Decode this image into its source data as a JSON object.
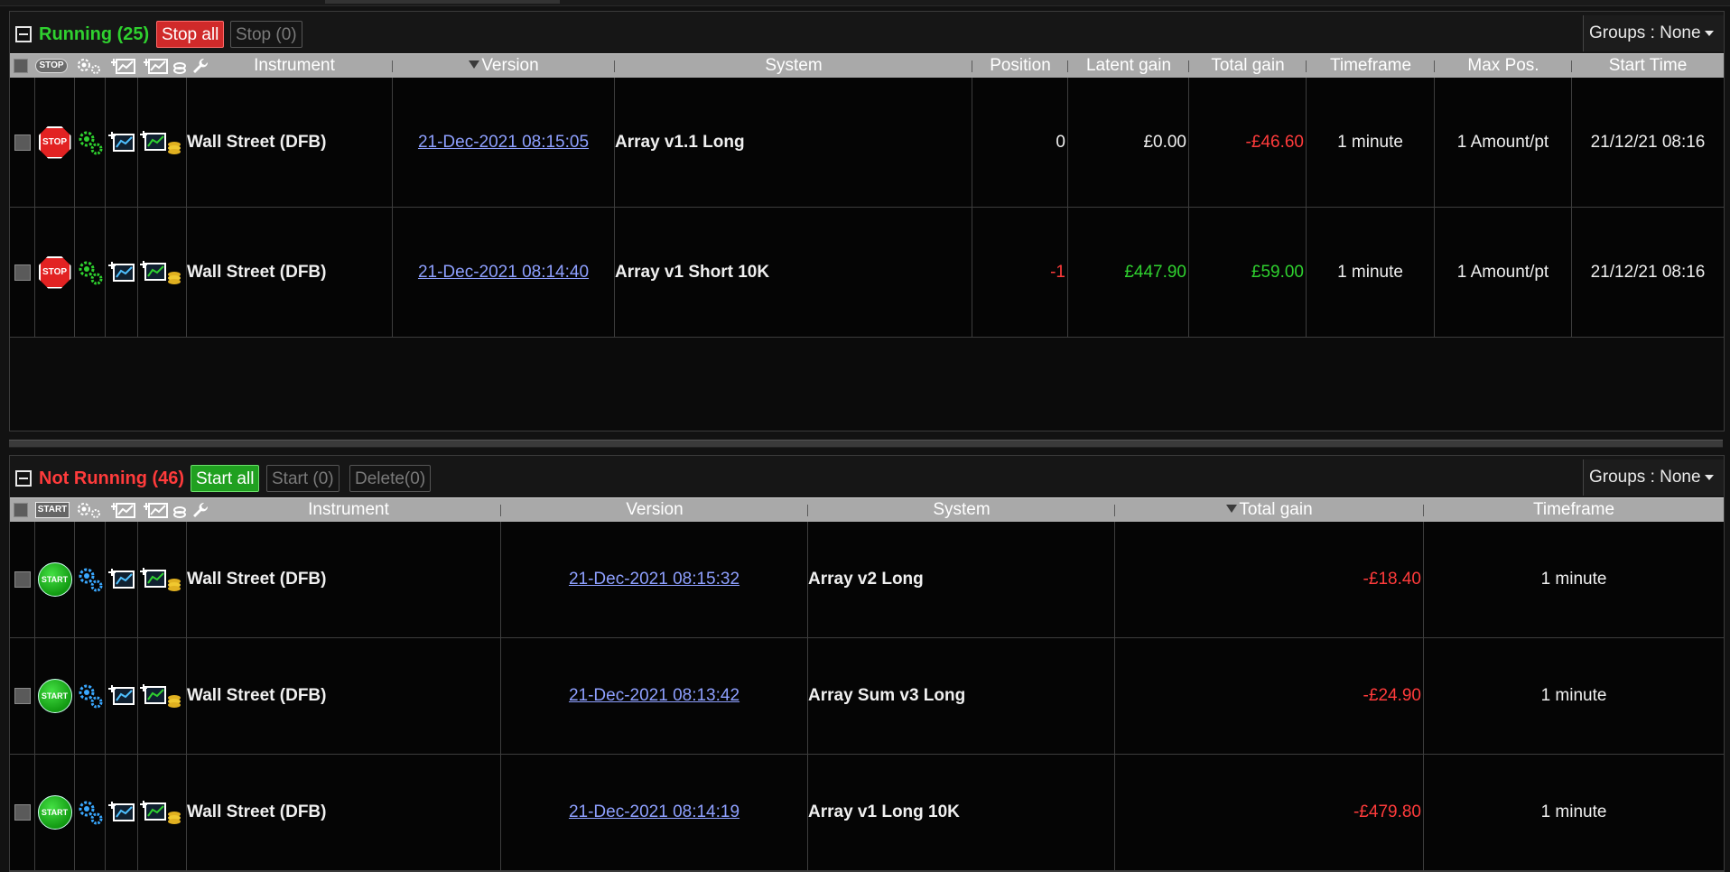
{
  "colors": {
    "running_title": "#2fd12f",
    "notrunning_title": "#ff3b3b",
    "negative": "#ff3b3b",
    "positive": "#2fd12f",
    "link": "#8ea0ff",
    "header_bg": "#a9a9a9"
  },
  "running": {
    "title": "Running (25)",
    "stop_all_label": "Stop all",
    "stop_label": "Stop (0)",
    "groups_label": "Groups : None",
    "header_icon_label": "STOP",
    "columns": {
      "instrument": "Instrument",
      "version": "Version",
      "system": "System",
      "position": "Position",
      "latent_gain": "Latent gain",
      "total_gain": "Total gain",
      "timeframe": "Timeframe",
      "max_pos": "Max Pos.",
      "start_time": "Start Time"
    },
    "rows": [
      {
        "action_icon": "STOP",
        "instrument": "Wall Street (DFB)",
        "version": "21-Dec-2021 08:15:05",
        "system": "Array v1.1 Long",
        "position": "0",
        "latent_gain": "£0.00",
        "total_gain": "-£46.60",
        "timeframe": "1 minute",
        "max_pos": "1 Amount/pt",
        "start_time": "21/12/21 08:16"
      },
      {
        "action_icon": "STOP",
        "instrument": "Wall Street (DFB)",
        "version": "21-Dec-2021 08:14:40",
        "system": "Array v1 Short 10K",
        "position": "-1",
        "latent_gain": "£447.90",
        "total_gain": "£59.00",
        "timeframe": "1 minute",
        "max_pos": "1 Amount/pt",
        "start_time": "21/12/21 08:16"
      }
    ]
  },
  "not_running": {
    "title": "Not Running (46)",
    "start_all_label": "Start all",
    "start_label": "Start (0)",
    "delete_label": "Delete(0)",
    "groups_label": "Groups : None",
    "header_icon_label": "START",
    "columns": {
      "instrument": "Instrument",
      "version": "Version",
      "system": "System",
      "total_gain": "Total gain",
      "timeframe": "Timeframe"
    },
    "rows": [
      {
        "action_icon": "START",
        "instrument": "Wall Street (DFB)",
        "version": "21-Dec-2021 08:15:32",
        "system": "Array v2 Long",
        "total_gain": "-£18.40",
        "timeframe": "1 minute"
      },
      {
        "action_icon": "START",
        "instrument": "Wall Street (DFB)",
        "version": "21-Dec-2021 08:13:42",
        "system": "Array Sum v3 Long",
        "total_gain": "-£24.90",
        "timeframe": "1 minute"
      },
      {
        "action_icon": "START",
        "instrument": "Wall Street (DFB)",
        "version": "21-Dec-2021 08:14:19",
        "system": "Array v1 Long 10K",
        "total_gain": "-£479.80",
        "timeframe": "1 minute"
      }
    ]
  }
}
